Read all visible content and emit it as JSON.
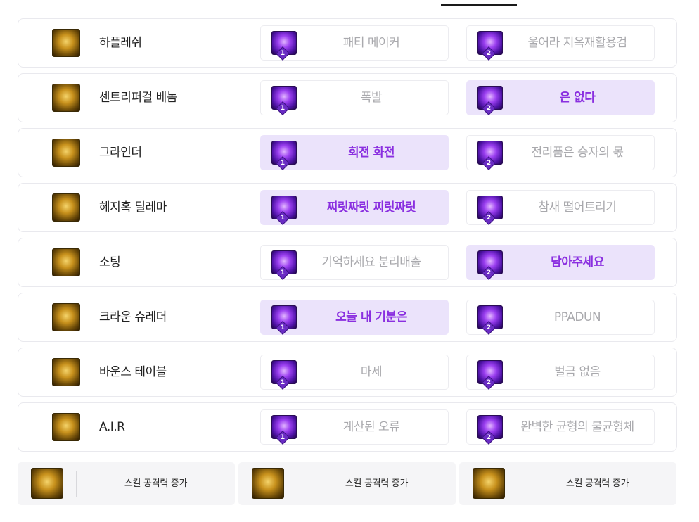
{
  "skills": [
    {
      "name": "하플레쉬",
      "icon": "haplash-icon",
      "options": [
        {
          "label": "패티 메이커",
          "tier": "1",
          "selected": false
        },
        {
          "label": "울어라 지옥재활용검",
          "tier": "2",
          "selected": false
        }
      ]
    },
    {
      "name": "센트리퍼걸 베놈",
      "icon": "centrifugal-venom-icon",
      "options": [
        {
          "label": "폭발",
          "tier": "1",
          "selected": false
        },
        {
          "label": "은 없다",
          "tier": "2",
          "selected": true
        }
      ]
    },
    {
      "name": "그라인더",
      "icon": "grinder-icon",
      "options": [
        {
          "label": "회전 화전",
          "tier": "1",
          "selected": true
        },
        {
          "label": "전리품은 승자의 몫",
          "tier": "2",
          "selected": false
        }
      ]
    },
    {
      "name": "헤지혹 딜레마",
      "icon": "hedgehog-dilemma-icon",
      "options": [
        {
          "label": "찌릿짜릿 찌릿짜릿",
          "tier": "1",
          "selected": true
        },
        {
          "label": "참새 떨어트리기",
          "tier": "2",
          "selected": false
        }
      ]
    },
    {
      "name": "소팅",
      "icon": "sorting-icon",
      "options": [
        {
          "label": "기억하세요 분리배출",
          "tier": "1",
          "selected": false
        },
        {
          "label": "담아주세요",
          "tier": "2",
          "selected": true
        }
      ]
    },
    {
      "name": "크라운 슈레더",
      "icon": "crown-shredder-icon",
      "options": [
        {
          "label": "오늘 내 기분은",
          "tier": "1",
          "selected": true
        },
        {
          "label": "PPADUN",
          "tier": "2",
          "selected": false
        }
      ]
    },
    {
      "name": "바운스 테이블",
      "icon": "bounce-table-icon",
      "options": [
        {
          "label": "마세",
          "tier": "1",
          "selected": false
        },
        {
          "label": "벌금 없음",
          "tier": "2",
          "selected": false
        }
      ]
    },
    {
      "name": "A.I.R",
      "icon": "air-icon",
      "options": [
        {
          "label": "계산된 오류",
          "tier": "1",
          "selected": false
        },
        {
          "label": "완벽한 균형의 불균형체",
          "tier": "2",
          "selected": false
        }
      ]
    }
  ],
  "bonuses": [
    {
      "label": "스킬 공격력 증가",
      "icon": "hedgehog-dilemma-icon"
    },
    {
      "label": "스킬 공격력 증가",
      "icon": "bounce-table-icon"
    },
    {
      "label": "스킬 공격력 증가",
      "icon": "air-icon"
    }
  ],
  "colors": {
    "selected_bg": "#ebe3fb",
    "selected_text": "#8a2fe0",
    "unselected_text": "#a9a9ad",
    "gold_icon": "#c8911c",
    "purple_icon": "#9b3ff0"
  }
}
